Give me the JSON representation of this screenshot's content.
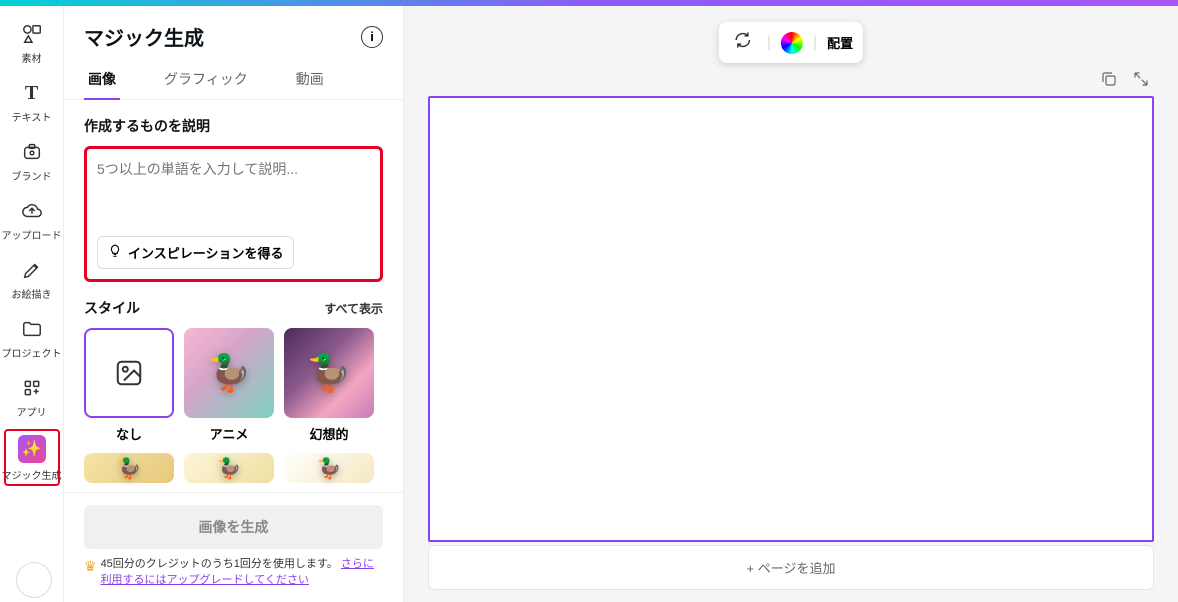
{
  "rail": {
    "items": [
      {
        "label": "素材",
        "icon": "shapes"
      },
      {
        "label": "テキスト",
        "icon": "T"
      },
      {
        "label": "ブランド",
        "icon": "brand"
      },
      {
        "label": "アップロード",
        "icon": "cloud"
      },
      {
        "label": "お絵描き",
        "icon": "pencil"
      },
      {
        "label": "プロジェクト",
        "icon": "folder"
      },
      {
        "label": "アプリ",
        "icon": "apps"
      },
      {
        "label": "マジック生成",
        "icon": "magic"
      }
    ]
  },
  "panel": {
    "title": "マジック生成",
    "tabs": [
      "画像",
      "グラフィック",
      "動画"
    ],
    "active_tab": 0,
    "describe_label": "作成するものを説明",
    "prompt_placeholder": "5つ以上の単語を入力して説明...",
    "inspiration_btn": "インスピレーションを得る",
    "style_label": "スタイル",
    "show_all": "すべて表示",
    "styles": [
      {
        "name": "なし"
      },
      {
        "name": "アニメ"
      },
      {
        "name": "幻想的"
      }
    ],
    "generate_btn": "画像を生成",
    "credits_text": "45回分のクレジットのうち1回分を使用します。",
    "credits_link": "さらに利用するにはアップグレードしてください"
  },
  "canvas": {
    "toolbar_position": "配置",
    "add_page": "+ ページを追加"
  }
}
